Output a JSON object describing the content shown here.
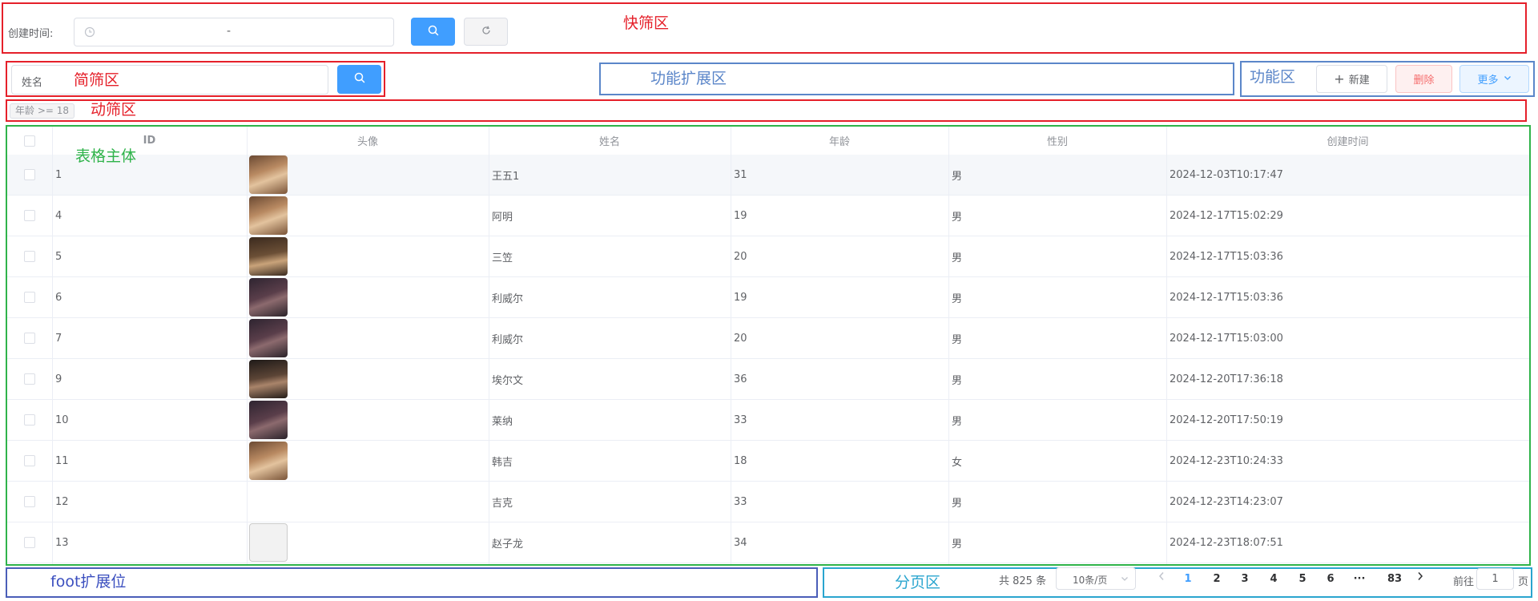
{
  "quick_filter": {
    "zone_label": "快筛区",
    "date_label": "创建时间:",
    "date_separator": "-"
  },
  "simple_filter": {
    "zone_label": "简筛区",
    "name_placeholder": "姓名"
  },
  "extension": {
    "zone_label": "功能扩展区"
  },
  "actions": {
    "zone_label": "功能区",
    "new_label": "新建",
    "delete_label": "删除",
    "more_label": "更多"
  },
  "dynamic_filter": {
    "zone_label": "动筛区",
    "tag_label": "年龄 >= 18"
  },
  "table": {
    "zone_label": "表格主体",
    "headers": [
      "ID",
      "头像",
      "姓名",
      "年龄",
      "性别",
      "创建时间"
    ],
    "rows": [
      {
        "id": "1",
        "avatar": "brown",
        "name": "王五1",
        "age": "31",
        "gender": "男",
        "created": "2024-12-03T10:17:47"
      },
      {
        "id": "4",
        "avatar": "brown",
        "name": "阿明",
        "age": "19",
        "gender": "男",
        "created": "2024-12-17T15:02:29"
      },
      {
        "id": "5",
        "avatar": "long-hair",
        "name": "三笠",
        "age": "20",
        "gender": "男",
        "created": "2024-12-17T15:03:36"
      },
      {
        "id": "6",
        "avatar": "dark",
        "name": "利威尔",
        "age": "19",
        "gender": "男",
        "created": "2024-12-17T15:03:36"
      },
      {
        "id": "7",
        "avatar": "dark",
        "name": "利威尔",
        "age": "20",
        "gender": "男",
        "created": "2024-12-17T15:03:00"
      },
      {
        "id": "9",
        "avatar": "portrait",
        "name": "埃尔文",
        "age": "36",
        "gender": "男",
        "created": "2024-12-20T17:36:18"
      },
      {
        "id": "10",
        "avatar": "dark",
        "name": "莱纳",
        "age": "33",
        "gender": "男",
        "created": "2024-12-20T17:50:19"
      },
      {
        "id": "11",
        "avatar": "brown",
        "name": "韩吉",
        "age": "18",
        "gender": "女",
        "created": "2024-12-23T10:24:33"
      },
      {
        "id": "12",
        "avatar": "",
        "name": "吉克",
        "age": "33",
        "gender": "男",
        "created": "2024-12-23T14:23:07"
      },
      {
        "id": "13",
        "avatar": "sketch",
        "name": "赵子龙",
        "age": "34",
        "gender": "男",
        "created": "2024-12-23T18:07:51"
      }
    ]
  },
  "footer": {
    "zone_label": "foot扩展位"
  },
  "pagination": {
    "zone_label": "分页区",
    "total_text": "共 825 条",
    "page_size": "10条/页",
    "pages": [
      "1",
      "2",
      "3",
      "4",
      "5",
      "6",
      "···",
      "83"
    ],
    "current_page": "1",
    "goto_label": "前往",
    "goto_value": "1",
    "goto_suffix": "页"
  },
  "colors": {
    "zone_red": "#e5202a",
    "zone_blue": "#4a5eb8",
    "zone_light_blue": "#5b86c9",
    "zone_green": "#2fb34a",
    "zone_cyan": "#2aa5cf",
    "primary": "#409eff",
    "danger": "#f56c6c"
  }
}
